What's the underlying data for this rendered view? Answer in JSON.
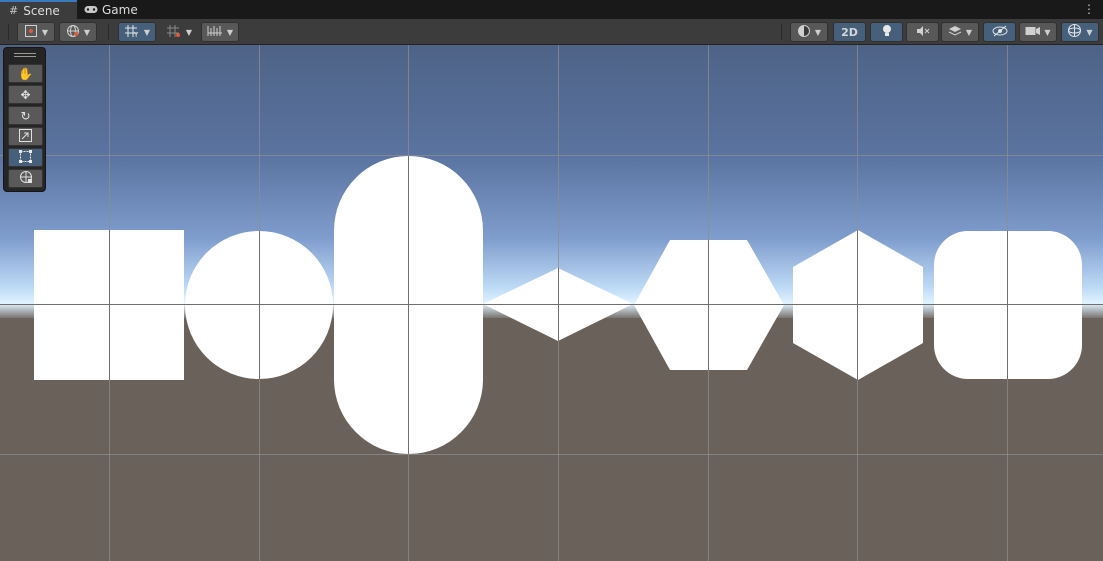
{
  "tabs": [
    {
      "label": "Scene",
      "icon": "grid-icon"
    },
    {
      "label": "Game",
      "icon": "gamepad-icon"
    }
  ],
  "toolbar": {
    "mode_2d_label": "2D"
  },
  "tools": [
    "view-tool",
    "move-tool",
    "rotate-tool",
    "scale-tool",
    "rect-tool",
    "transform-tool"
  ],
  "selected_tool": "rect-tool",
  "colors": {
    "sky_top": "#4e6386",
    "sky_mid": "#637ba5",
    "horizon": "#e2f3ff",
    "ground": "#6a625a",
    "grid": "#8e8e8e",
    "shape_fill": "#ffffff",
    "accent": "#46607c"
  },
  "shapes": [
    "square",
    "circle",
    "capsule",
    "diamond",
    "hexagon-flat",
    "hexagon-pointy",
    "rounded-square"
  ]
}
